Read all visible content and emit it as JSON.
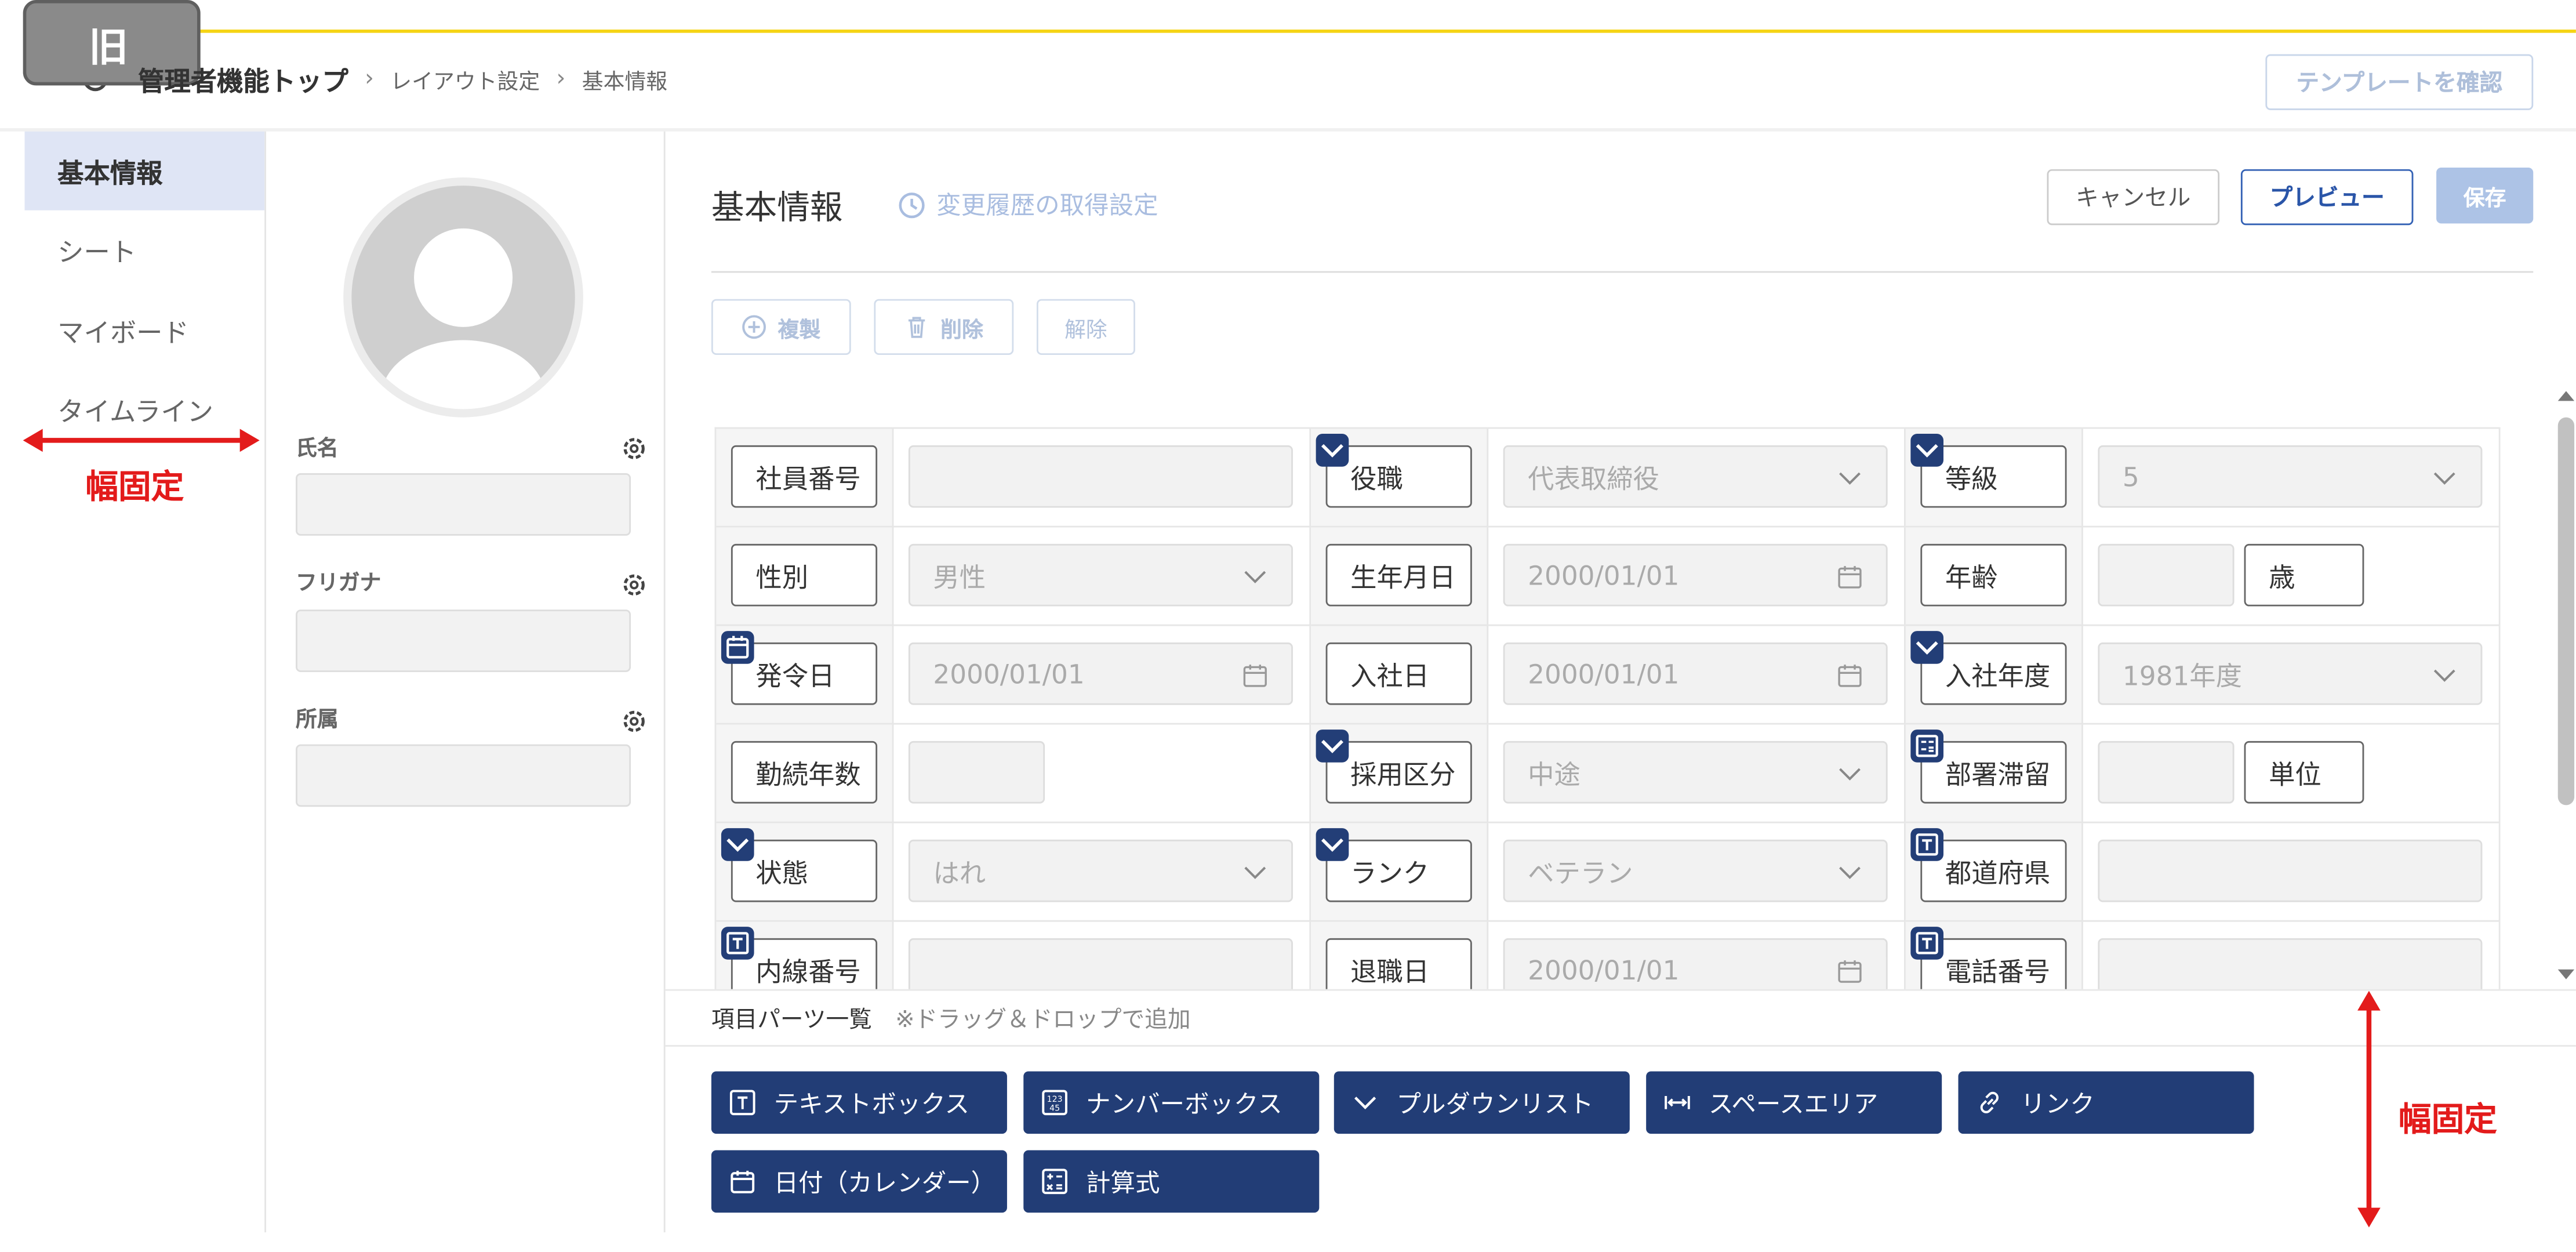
{
  "badge": {
    "label": "旧"
  },
  "breadcrumb": {
    "root": "管理者機能トップ",
    "layout": "レイアウト設定",
    "current": "基本情報"
  },
  "header": {
    "template_button": "テンプレートを確認"
  },
  "sidebar": {
    "items": [
      {
        "label": "基本情報",
        "active": true
      },
      {
        "label": "シート",
        "active": false
      },
      {
        "label": "マイボード",
        "active": false
      },
      {
        "label": "タイムライン",
        "active": false
      }
    ]
  },
  "annotations": {
    "fixed_width_left": "幅固定",
    "fixed_width_right": "幅固定"
  },
  "profile": {
    "fields": [
      {
        "label": "氏名",
        "value": ""
      },
      {
        "label": "フリガナ",
        "value": ""
      },
      {
        "label": "所属",
        "value": ""
      }
    ]
  },
  "main": {
    "title": "基本情報",
    "history_link": "変更履歴の取得設定",
    "cancel": "キャンセル",
    "preview": "プレビュー",
    "save": "保存",
    "toolbar": {
      "copy": "複製",
      "delete": "削除",
      "release": "解除"
    }
  },
  "grid": {
    "rows": [
      [
        {
          "label": "社員番号",
          "badge": "",
          "type": "text",
          "value": ""
        },
        {
          "label": "役職",
          "badge": "dropdown",
          "type": "select",
          "value": "代表取締役"
        },
        {
          "label": "等級",
          "badge": "dropdown",
          "type": "select",
          "value": "5"
        }
      ],
      [
        {
          "label": "性別",
          "badge": "",
          "type": "select",
          "value": "男性"
        },
        {
          "label": "生年月日",
          "badge": "",
          "type": "date",
          "value": "2000/01/01"
        },
        {
          "label": "年齢",
          "badge": "",
          "type": "unit",
          "value": "",
          "unit": "歳"
        }
      ],
      [
        {
          "label": "発令日",
          "badge": "calendar",
          "type": "date",
          "value": "2000/01/01"
        },
        {
          "label": "入社日",
          "badge": "",
          "type": "date",
          "value": "2000/01/01"
        },
        {
          "label": "入社年度",
          "badge": "dropdown",
          "type": "select",
          "value": "1981年度"
        }
      ],
      [
        {
          "label": "勤続年数",
          "badge": "",
          "type": "short",
          "value": ""
        },
        {
          "label": "採用区分",
          "badge": "dropdown",
          "type": "select",
          "value": "中途"
        },
        {
          "label": "部署滞留",
          "badge": "calc",
          "type": "unit",
          "value": "",
          "unit": "単位"
        }
      ],
      [
        {
          "label": "状態",
          "badge": "dropdown",
          "type": "select",
          "value": "はれ"
        },
        {
          "label": "ランク",
          "badge": "dropdown",
          "type": "select",
          "value": "ベテラン"
        },
        {
          "label": "都道府県",
          "badge": "text",
          "type": "text",
          "value": ""
        }
      ],
      [
        {
          "label": "内線番号",
          "badge": "text",
          "type": "text",
          "value": ""
        },
        {
          "label": "退職日",
          "badge": "",
          "type": "date",
          "value": "2000/01/01"
        },
        {
          "label": "電話番号",
          "badge": "text",
          "type": "text",
          "value": ""
        }
      ]
    ]
  },
  "parts": {
    "title": "項目パーツ一覧",
    "note": "※ドラッグ＆ドロップで追加",
    "items": [
      {
        "label": "テキストボックス",
        "icon": "text-icon"
      },
      {
        "label": "ナンバーボックス",
        "icon": "number-icon"
      },
      {
        "label": "プルダウンリスト",
        "icon": "chevron-down-icon"
      },
      {
        "label": "スペースエリア",
        "icon": "space-icon"
      },
      {
        "label": "リンク",
        "icon": "link-icon"
      },
      {
        "label": "日付（カレンダー）",
        "icon": "calendar-icon"
      },
      {
        "label": "計算式",
        "icon": "calculator-icon"
      }
    ]
  },
  "colors": {
    "accent": "#223d76",
    "annotation": "#e31b1b",
    "active_sidebar": "#dfe5f5",
    "top_line": "#f5d415"
  }
}
